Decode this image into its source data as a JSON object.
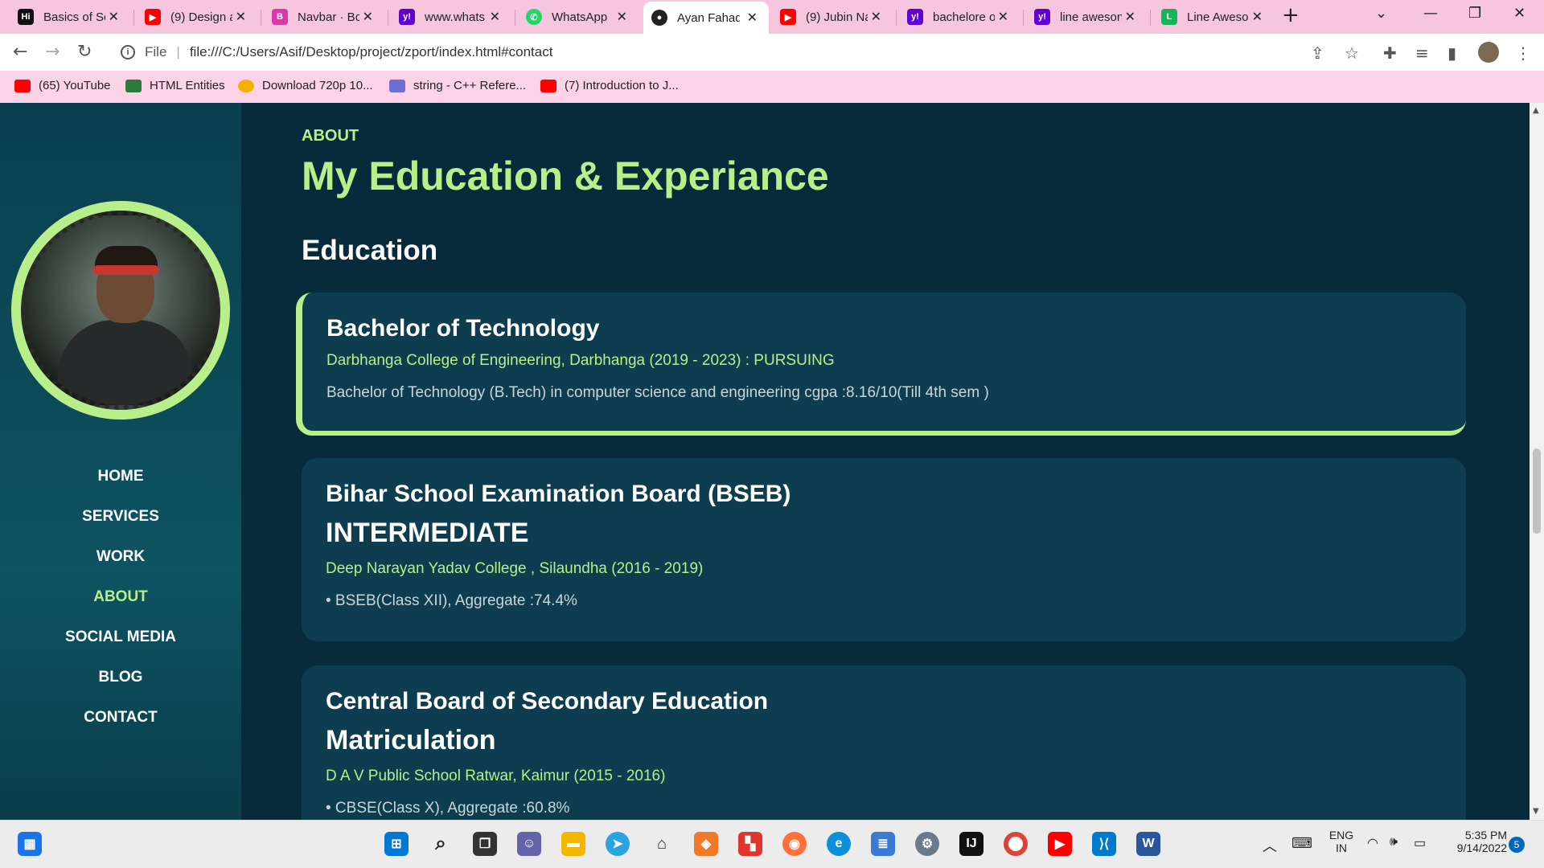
{
  "browser": {
    "tabs": [
      {
        "label": "Basics of Se",
        "favicon_color": "#111111",
        "favicon_text": "Hi"
      },
      {
        "label": "(9) Design a",
        "favicon_color": "#ff0000",
        "favicon_text": "▶"
      },
      {
        "label": "Navbar · Bo",
        "favicon_color": "#7952b3",
        "favicon_text": "B"
      },
      {
        "label": "www.whats",
        "favicon_color": "#6001d2",
        "favicon_text": "y!"
      },
      {
        "label": "WhatsApp",
        "favicon_color": "#25d366",
        "favicon_text": "✆"
      },
      {
        "label": "Ayan Fahad",
        "favicon_color": "#222222",
        "favicon_text": "●"
      },
      {
        "label": "(9) Jubin Na",
        "favicon_color": "#ff0000",
        "favicon_text": "▶"
      },
      {
        "label": "bachelore o",
        "favicon_color": "#6001d2",
        "favicon_text": "y!"
      },
      {
        "label": "line aweson",
        "favicon_color": "#6001d2",
        "favicon_text": "y!"
      },
      {
        "label": "Line Aweso",
        "favicon_color": "#1bb35a",
        "favicon_text": "L"
      }
    ],
    "active_tab_index": 5,
    "address": {
      "scheme_label": "File",
      "url": "file:///C:/Users/Asif/Desktop/project/zport/index.html#contact"
    },
    "bookmarks": [
      {
        "label": "(65) YouTube",
        "color": "#ff0000"
      },
      {
        "label": "HTML Entities",
        "color": "#2a7a3b"
      },
      {
        "label": "Download 720p 10...",
        "color": "#f2b300"
      },
      {
        "label": "string - C++ Refere...",
        "color": "#6b6fd6"
      },
      {
        "label": "(7) Introduction to J...",
        "color": "#ff0000"
      }
    ]
  },
  "sidebar": {
    "nav": [
      {
        "label": "HOME",
        "active": false
      },
      {
        "label": "SERVICES",
        "active": false
      },
      {
        "label": "WORK",
        "active": false
      },
      {
        "label": "ABOUT",
        "active": true
      },
      {
        "label": "SOCIAL MEDIA",
        "active": false
      },
      {
        "label": "BLOG",
        "active": false
      },
      {
        "label": "CONTACT",
        "active": false
      }
    ]
  },
  "main": {
    "eyebrow": "ABOUT",
    "headline": "My Education & Experiance",
    "section_title": "Education",
    "cards": [
      {
        "title": "Bachelor of Technology",
        "subtitle": "",
        "org": "Darbhanga College of Engineering, Darbhanga (2019 - 2023) : PURSUING",
        "desc": "Bachelor of Technology (B.Tech) in computer science and engineering cgpa :8.16/10(Till 4th sem )"
      },
      {
        "title": "Bihar School Examination Board (BSEB)",
        "subtitle": "INTERMEDIATE",
        "org": "Deep Narayan Yadav College , Silaundha (2016 - 2019)",
        "desc": "• BSEB(Class XII), Aggregate :74.4%"
      },
      {
        "title": "Central Board of Secondary Education",
        "subtitle": "Matriculation",
        "org": "D A V Public School Ratwar, Kaimur (2015 - 2016)",
        "desc": "• CBSE(Class X), Aggregate :60.8%"
      }
    ]
  },
  "taskbar": {
    "lang": "ENG",
    "region": "IN",
    "time": "5:35 PM",
    "date": "9/14/2022",
    "notification_count": "5"
  },
  "colors": {
    "accent": "#b8ef8a",
    "background": "#072b3b",
    "card": "#0d3d4e",
    "tabbar": "#f6c6df"
  }
}
